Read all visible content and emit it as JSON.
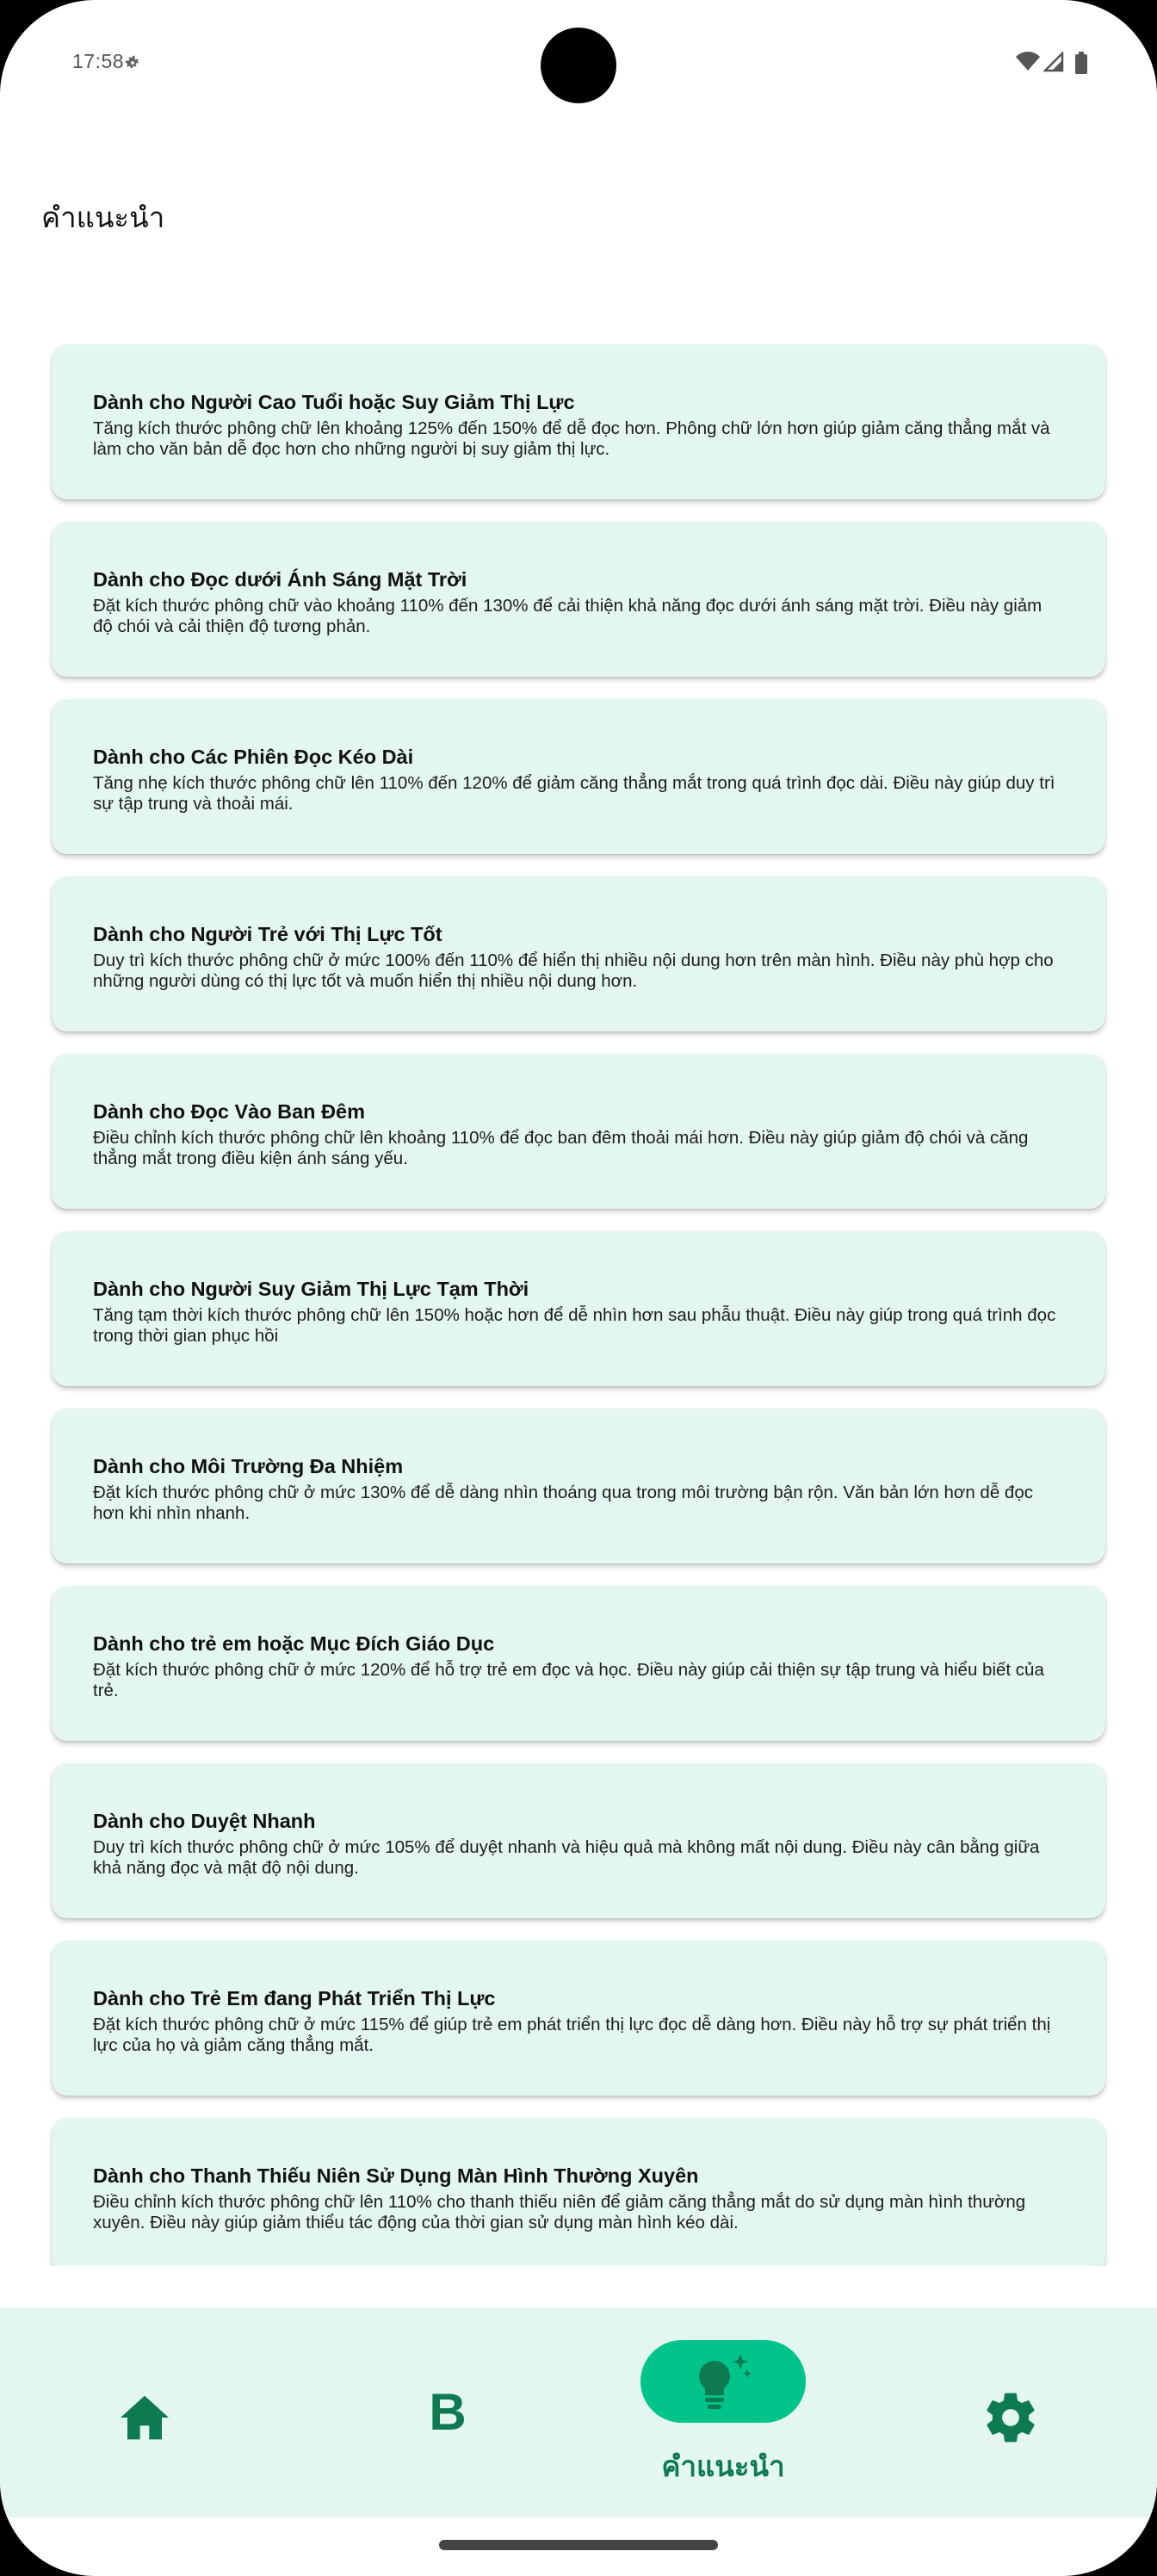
{
  "status_bar": {
    "time": "17:58",
    "icons": [
      "gear-icon",
      "wifi-icon",
      "signal-icon",
      "battery-icon"
    ]
  },
  "header": {
    "title": "คำแนะนำ"
  },
  "cards": [
    {
      "title": "Dành cho Người Cao Tuổi hoặc Suy Giảm Thị Lực",
      "description": "Tăng kích thước phông chữ lên khoảng 125% đến 150% để dễ đọc hơn. Phông chữ lớn hơn giúp giảm căng thẳng mắt và làm cho văn bản dễ đọc hơn cho những người bị suy giảm thị lực."
    },
    {
      "title": "Dành cho Đọc dưới Ánh Sáng Mặt Trời",
      "description": "Đặt kích thước phông chữ vào khoảng 110% đến 130% để cải thiện khả năng đọc dưới ánh sáng mặt trời. Điều này giảm độ chói và cải thiện độ tương phản."
    },
    {
      "title": "Dành cho Các Phiên Đọc Kéo Dài",
      "description": "Tăng nhẹ kích thước phông chữ lên 110% đến 120% để giảm căng thẳng mắt trong quá trình đọc dài. Điều này giúp duy trì sự tập trung và thoải mái."
    },
    {
      "title": "Dành cho Người Trẻ với Thị Lực Tốt",
      "description": "Duy trì kích thước phông chữ ở mức 100% đến 110% để hiển thị nhiều nội dung hơn trên màn hình. Điều này phù hợp cho những người dùng có thị lực tốt và muốn hiển thị nhiều nội dung hơn."
    },
    {
      "title": "Dành cho Đọc Vào Ban Đêm",
      "description": "Điều chỉnh kích thước phông chữ lên khoảng 110% để đọc ban đêm thoải mái hơn. Điều này giúp giảm độ chói và căng thẳng mắt trong điều kiện ánh sáng yếu."
    },
    {
      "title": "Dành cho Người Suy Giảm Thị Lực Tạm Thời",
      "description": "Tăng tạm thời kích thước phông chữ lên 150% hoặc hơn để dễ nhìn hơn sau phẫu thuật. Điều này giúp trong quá trình đọc trong thời gian phục hồi"
    },
    {
      "title": "Dành cho Môi Trường Đa Nhiệm",
      "description": "Đặt kích thước phông chữ ở mức 130% để dễ dàng nhìn thoáng qua trong môi trường bận rộn. Văn bản lớn hơn dễ đọc hơn khi nhìn nhanh."
    },
    {
      "title": "Dành cho trẻ em hoặc Mục Đích Giáo Dục",
      "description": "Đặt kích thước phông chữ ở mức 120% để hỗ trợ trẻ em đọc và học. Điều này giúp cải thiện sự tập trung và hiểu biết của trẻ."
    },
    {
      "title": "Dành cho Duyệt Nhanh",
      "description": "Duy trì kích thước phông chữ ở mức 105% để duyệt nhanh và hiệu quả mà không mất nội dung. Điều này cân bằng giữa khả năng đọc và mật độ nội dung."
    },
    {
      "title": "Dành cho Trẻ Em đang Phát Triển Thị Lực",
      "description": "Đặt kích thước phông chữ ở mức 115% để giúp trẻ em phát triển thị lực đọc dễ dàng hơn. Điều này hỗ trợ sự phát triển thị lực của họ và giảm căng thẳng mắt."
    },
    {
      "title": "Dành cho Thanh Thiếu Niên Sử Dụng Màn Hình Thường Xuyên",
      "description": "Điều chỉnh kích thước phông chữ lên 110% cho thanh thiếu niên để giảm căng thẳng mắt do sử dụng màn hình thường xuyên. Điều này giúp giảm thiểu tác động của thời gian sử dụng màn hình kéo dài."
    }
  ],
  "bottom_nav": {
    "items": [
      {
        "icon": "home-icon"
      },
      {
        "icon": "bold-b-icon",
        "glyph": "B"
      },
      {
        "icon": "lightbulb-sparkle-icon",
        "label": "คำแนะนำ",
        "selected": true
      },
      {
        "icon": "gear-icon"
      }
    ]
  },
  "colors": {
    "accent": "#00c48a",
    "accent_dark": "#0e7a52",
    "card_bg": "#e3f6f0",
    "nav_bg": "#e3f6f0"
  }
}
